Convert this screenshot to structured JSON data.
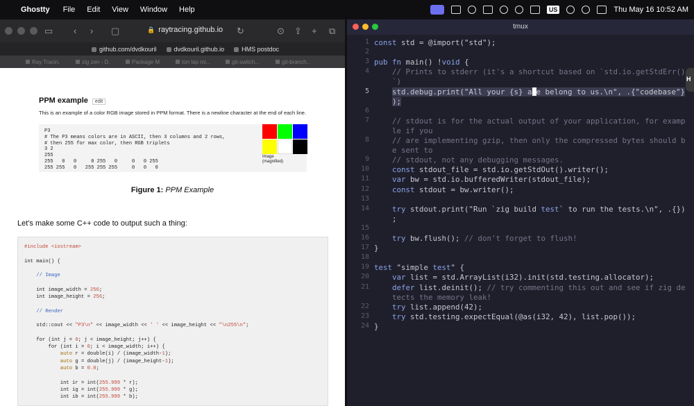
{
  "menubar": {
    "app_name": "Ghostty",
    "items": [
      "File",
      "Edit",
      "View",
      "Window",
      "Help"
    ],
    "keyboard_layout": "US",
    "datetime": "Thu May 16  10:52 AM"
  },
  "safari": {
    "url": "raytracing.github.io",
    "favorites": [
      "github.com/dvdkouril",
      "dvdkouril.github.io",
      "HMS postdoc"
    ],
    "tabs": [
      "Ray Tracin...",
      "zig zen - D...",
      "Package M...",
      "ton lap mi...",
      "git-switch...",
      "git-branch..."
    ],
    "page": {
      "section_title": "PPM example",
      "edit_label": "edit",
      "description": "This is an example of a color RGB image stored in PPM format. There is a newline character at the end of each line.",
      "ppm_code": "P3\n# The P3 means colors are in ASCII, then 3 columns and 2 rows,\n# then 255 for max color, then RGB triplets\n3 2\n255\n255   0   0     0 255   0     0   0 255\n255 255   0   255 255 255     0   0   0",
      "swatch_colors": [
        "#ff0000",
        "#00ff00",
        "#0000ff",
        "#ffff00",
        "#ffffff",
        "#000000"
      ],
      "image_caption": "Image\n(magnified)",
      "figure_label": "Figure 1:",
      "figure_title": "PPM Example",
      "lead_text": "Let's make some C++ code to output such a thing:"
    }
  },
  "tmux": {
    "title": "tmux",
    "lines": [
      {
        "n": "1",
        "text": "const std = @import(\"std\");"
      },
      {
        "n": "2",
        "text": ""
      },
      {
        "n": "3",
        "text": "pub fn main() !void {"
      },
      {
        "n": "4",
        "text": "    // Prints to stderr (it's a shortcut based on `std.io.getStdErr()"
      },
      {
        "n": "",
        "text": "    `)"
      },
      {
        "n": "5",
        "text": "    std.debug.print(\"All your {s} are belong to us.\\n\", .{\"codebase\"}"
      },
      {
        "n": "",
        "text": "    );"
      },
      {
        "n": "6",
        "text": ""
      },
      {
        "n": "7",
        "text": "    // stdout is for the actual output of your application, for examp"
      },
      {
        "n": "",
        "text": "    le if you"
      },
      {
        "n": "8",
        "text": "    // are implementing gzip, then only the compressed bytes should b"
      },
      {
        "n": "",
        "text": "    e sent to"
      },
      {
        "n": "9",
        "text": "    // stdout, not any debugging messages."
      },
      {
        "n": "10",
        "text": "    const stdout_file = std.io.getStdOut().writer();"
      },
      {
        "n": "11",
        "text": "    var bw = std.io.bufferedWriter(stdout_file);"
      },
      {
        "n": "12",
        "text": "    const stdout = bw.writer();"
      },
      {
        "n": "13",
        "text": ""
      },
      {
        "n": "14",
        "text": "    try stdout.print(\"Run `zig build test` to run the tests.\\n\", .{})"
      },
      {
        "n": "",
        "text": "    ;"
      },
      {
        "n": "15",
        "text": ""
      },
      {
        "n": "16",
        "text": "    try bw.flush(); // don't forget to flush!"
      },
      {
        "n": "17",
        "text": "}"
      },
      {
        "n": "18",
        "text": ""
      },
      {
        "n": "19",
        "text": "test \"simple test\" {"
      },
      {
        "n": "20",
        "text": "    var list = std.ArrayList(i32).init(std.testing.allocator);"
      },
      {
        "n": "21",
        "text": "    defer list.deinit(); // try commenting this out and see if zig de"
      },
      {
        "n": "",
        "text": "    tects the memory leak!"
      },
      {
        "n": "22",
        "text": "    try list.append(42);"
      },
      {
        "n": "23",
        "text": "    try std.testing.expectEqual(@as(i32, 42), list.pop());"
      },
      {
        "n": "24",
        "text": "}"
      }
    ],
    "current_line": "5"
  },
  "corner_label": "H"
}
